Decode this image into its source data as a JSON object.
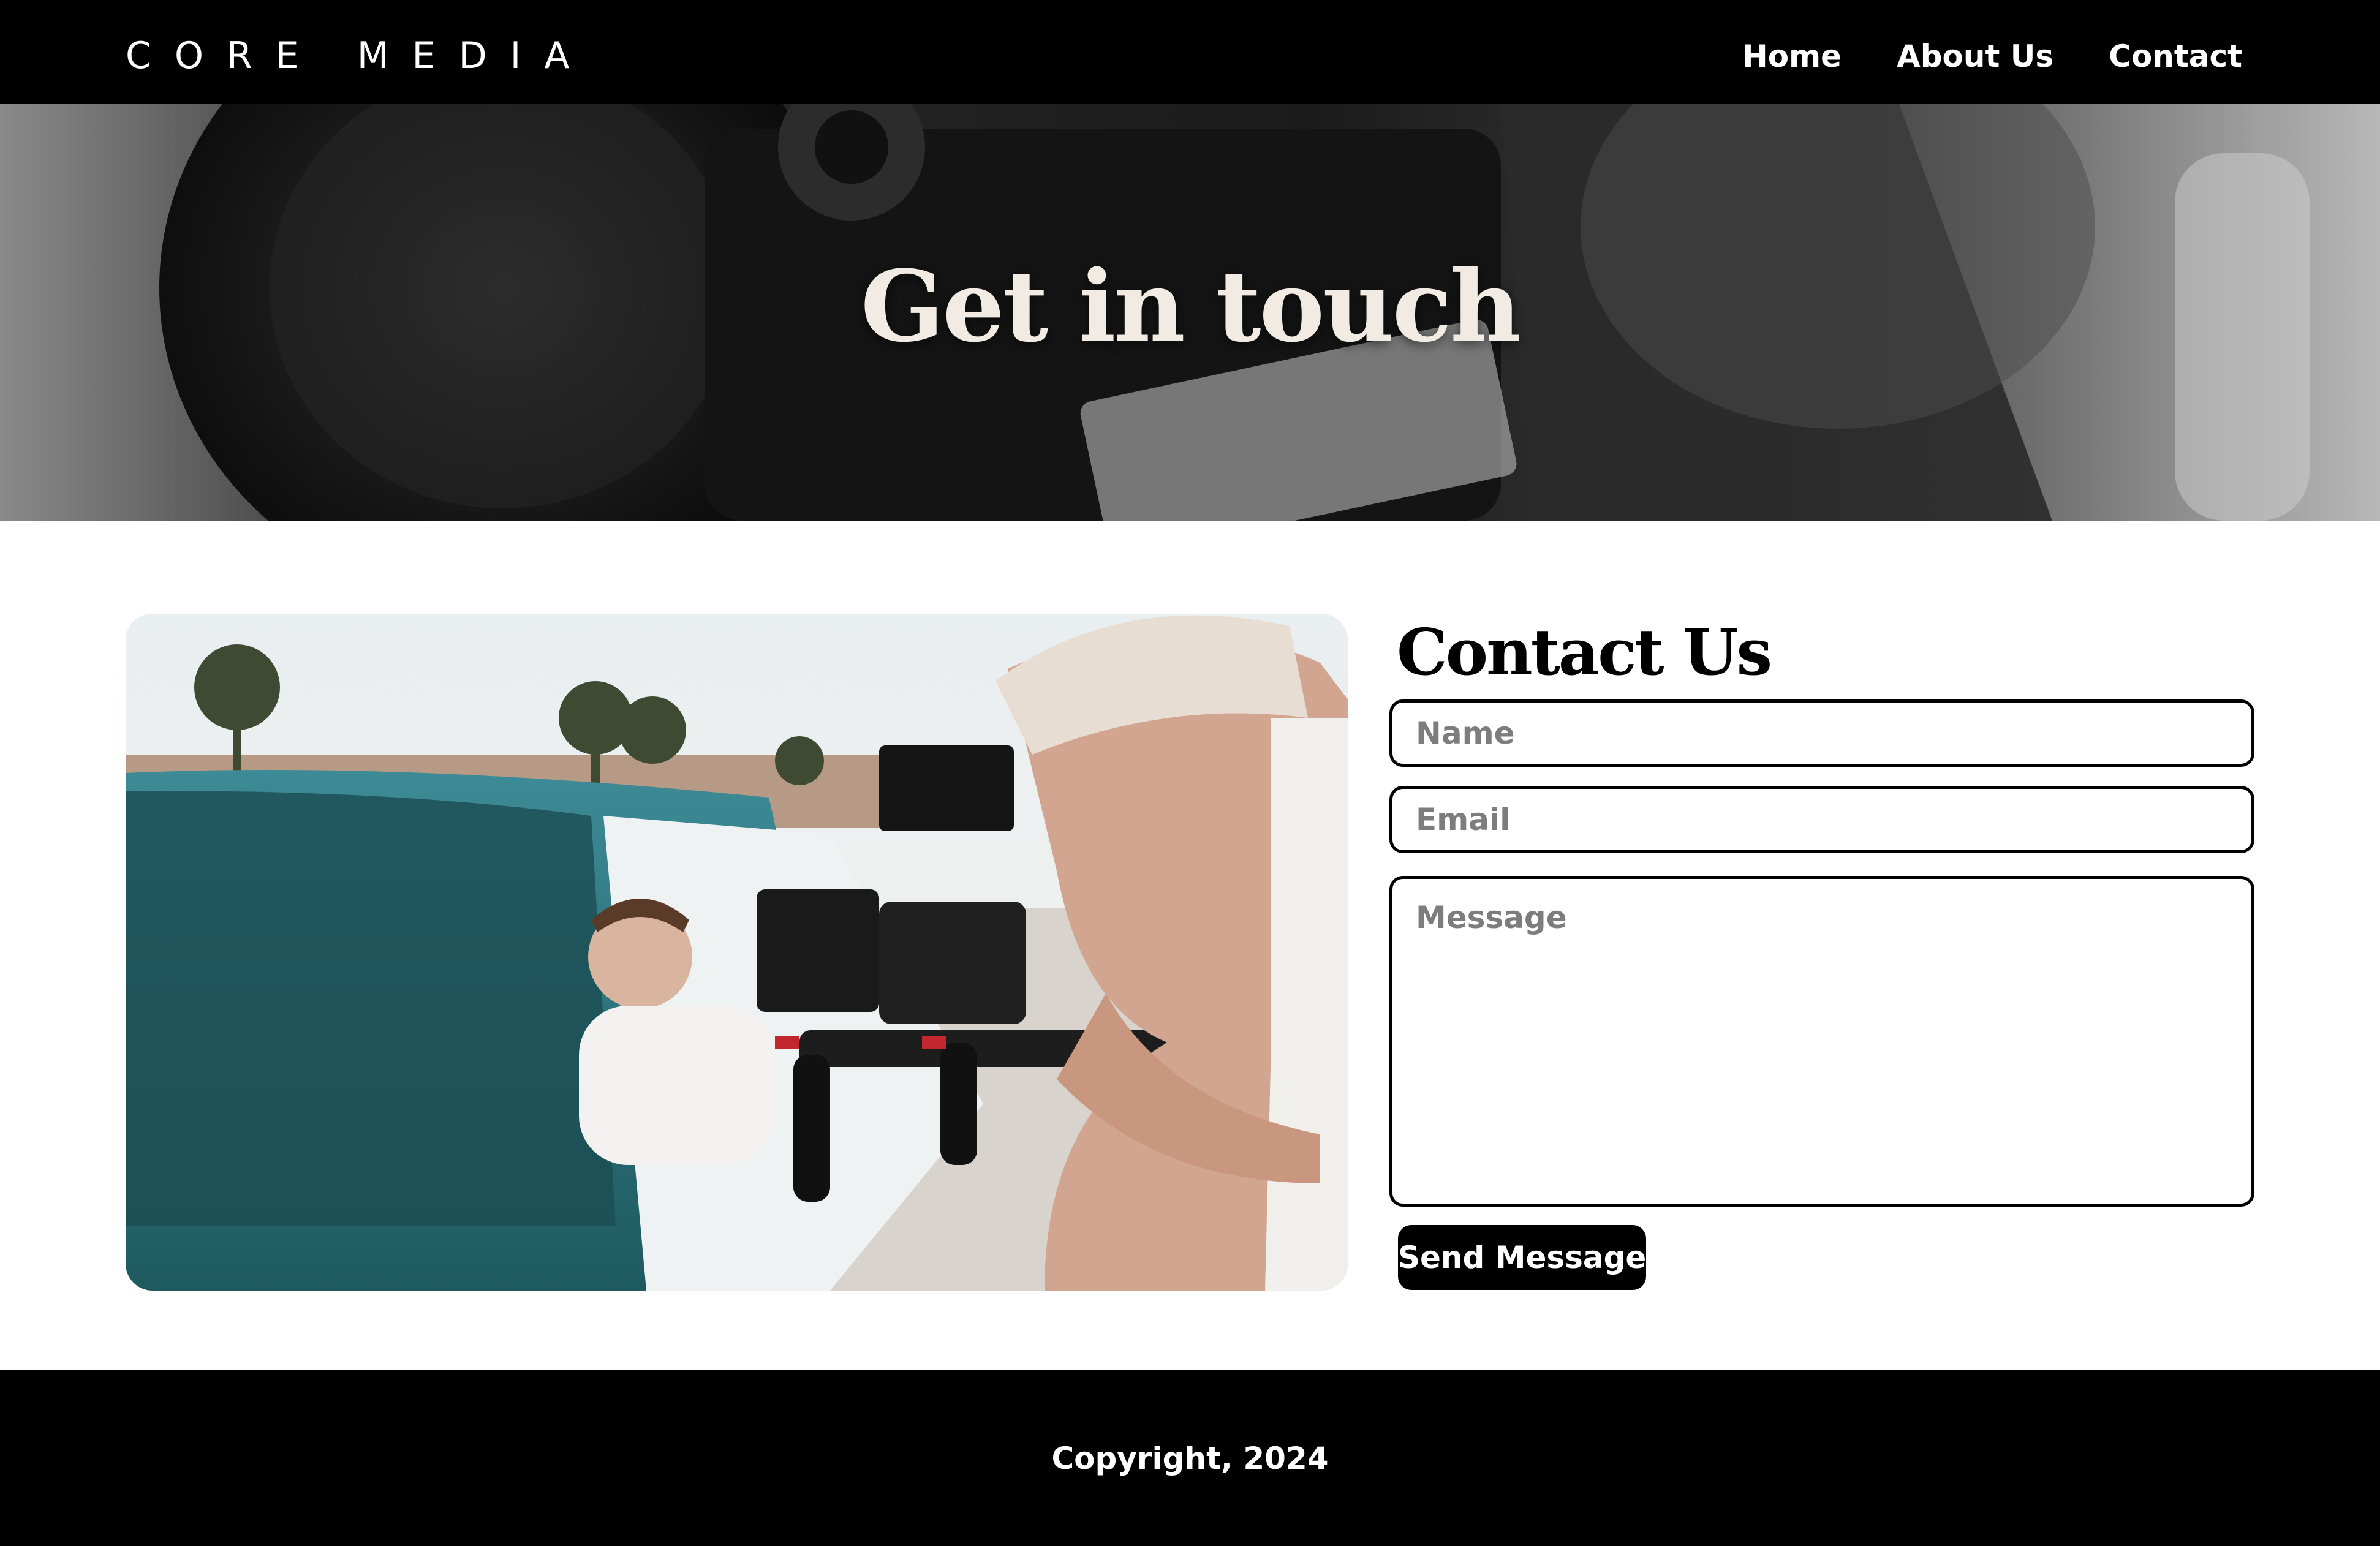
{
  "header": {
    "brand": "CORE MEDIA",
    "nav": [
      {
        "label": "Home"
      },
      {
        "label": "About Us"
      },
      {
        "label": "Contact"
      }
    ]
  },
  "hero": {
    "title": "Get in touch",
    "image": "camera-closeup-photo"
  },
  "main": {
    "image": "videographer-filming-car-photo",
    "heading": "Contact Us",
    "form": {
      "name_placeholder": "Name",
      "email_placeholder": "Email",
      "message_placeholder": "Message",
      "submit_label": "Send Message"
    }
  },
  "footer": {
    "copyright": "Copyright, 2024"
  }
}
